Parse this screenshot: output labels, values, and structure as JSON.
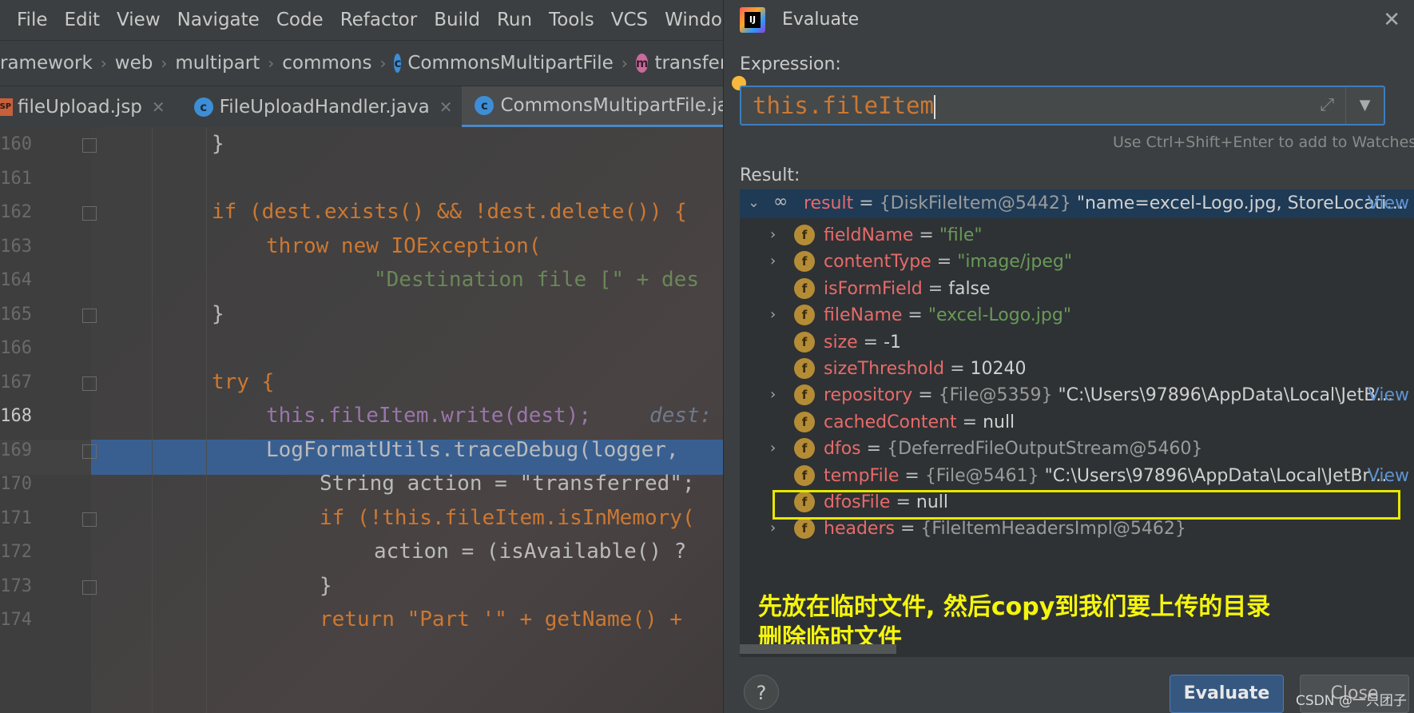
{
  "menu": [
    "File",
    "Edit",
    "View",
    "Navigate",
    "Code",
    "Refactor",
    "Build",
    "Run",
    "Tools",
    "VCS",
    "Window"
  ],
  "breadcrumbs": [
    "ramework",
    "web",
    "multipart",
    "commons",
    "CommonsMultipartFile",
    "transferTo"
  ],
  "tabs": [
    {
      "label": "fileUpload.jsp",
      "icon": "jsp-file-icon"
    },
    {
      "label": "FileUploadHandler.java",
      "icon": "class-icon"
    },
    {
      "label": "CommonsMultipartFile.java",
      "icon": "class-icon",
      "active": true
    }
  ],
  "code": {
    "line_numbers": [
      "160",
      "161",
      "162",
      "163",
      "164",
      "165",
      "166",
      "167",
      "168",
      "169",
      "170",
      "171",
      "172",
      "173",
      "174"
    ],
    "current_line": "168",
    "lines": [
      "}",
      "",
      "if (dest.exists() && !dest.delete()) {",
      "throw new IOException(",
      "\"Destination file [\" + des",
      "}",
      "",
      "try {",
      "this.fileItem.write(dest);",
      "LogFormatUtils.traceDebug(logger,",
      "String action = \"transferred\";",
      "if (!this.fileItem.isInMemory(",
      "action = (isAvailable() ?",
      "}",
      "return \"Part '\" + getName() +"
    ],
    "inline_hint": "dest:"
  },
  "dialog": {
    "title": "Evaluate",
    "expression_label": "Expression:",
    "expression": "this.fileItem",
    "hint": "Use Ctrl+Shift+Enter to add to Watches",
    "result_label": "Result:",
    "result_root": {
      "name": "result",
      "eq": "=",
      "type": "{DiskFileItem@5442}",
      "value": "\"name=excel-Logo.jpg, StoreLocati…",
      "view": "View"
    },
    "fields": [
      {
        "name": "fieldName",
        "type": "",
        "value": "\"file\"",
        "kind": "str",
        "expandable": true
      },
      {
        "name": "contentType",
        "type": "",
        "value": "\"image/jpeg\"",
        "kind": "str",
        "expandable": true
      },
      {
        "name": "isFormField",
        "type": "",
        "value": "false",
        "kind": "plain",
        "expandable": false
      },
      {
        "name": "fileName",
        "type": "",
        "value": "\"excel-Logo.jpg\"",
        "kind": "str",
        "expandable": true
      },
      {
        "name": "size",
        "type": "",
        "value": "-1",
        "kind": "plain",
        "expandable": false
      },
      {
        "name": "sizeThreshold",
        "type": "",
        "value": "10240",
        "kind": "plain",
        "expandable": false
      },
      {
        "name": "repository",
        "type": "{File@5359}",
        "value": "\"C:\\Users\\97896\\AppData\\Local\\JetB…",
        "kind": "plain",
        "expandable": true,
        "view": "View"
      },
      {
        "name": "cachedContent",
        "type": "",
        "value": "null",
        "kind": "plain",
        "expandable": false
      },
      {
        "name": "dfos",
        "type": "{DeferredFileOutputStream@5460}",
        "value": "",
        "kind": "plain",
        "expandable": true
      },
      {
        "name": "tempFile",
        "type": "{File@5461}",
        "value": "\"C:\\Users\\97896\\AppData\\Local\\JetBr…",
        "kind": "plain",
        "expandable": false,
        "view": "View"
      },
      {
        "name": "dfosFile",
        "type": "",
        "value": "null",
        "kind": "plain",
        "expandable": false
      },
      {
        "name": "headers",
        "type": "{FileItemHeadersImpl@5462}",
        "value": "",
        "kind": "plain",
        "expandable": true
      }
    ],
    "annotation_line1": "先放在临时文件, 然后copy到我们要上传的目录",
    "annotation_line2": "删除临时文件",
    "help_label": "?",
    "evaluate_label": "Evaluate",
    "close_label": "Close"
  },
  "watermark": "CSDN @一只团子",
  "colors": {
    "accent": "#4a88c7",
    "highlight_row": "#395f91",
    "annotation": "#f5f50d",
    "evaluate_button": "#365880"
  }
}
